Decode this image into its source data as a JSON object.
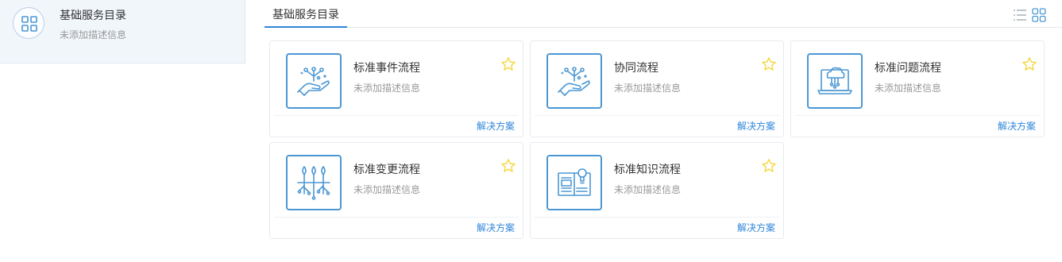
{
  "sidebar": {
    "items": [
      {
        "title": "基础服务目录",
        "description": "未添加描述信息",
        "icon": "grid-apps-icon"
      }
    ]
  },
  "main": {
    "tab_label": "基础服务目录",
    "view_toggle": {
      "list_icon": "list-view-icon",
      "grid_icon": "grid-view-icon",
      "active": "grid"
    }
  },
  "cards": [
    {
      "title": "标准事件流程",
      "description": "未添加描述信息",
      "link": "解决方案",
      "icon": "hand-network-icon"
    },
    {
      "title": "协同流程",
      "description": "未添加描述信息",
      "link": "解决方案",
      "icon": "hand-network-icon"
    },
    {
      "title": "标准问题流程",
      "description": "未添加描述信息",
      "link": "解决方案",
      "icon": "cloud-laptop-icon"
    },
    {
      "title": "标准变更流程",
      "description": "未添加描述信息",
      "link": "解决方案",
      "icon": "plant-circuit-icon"
    },
    {
      "title": "标准知识流程",
      "description": "未添加描述信息",
      "link": "解决方案",
      "icon": "book-idea-icon"
    }
  ],
  "colors": {
    "accent": "#2f86d9",
    "icon_border": "#4b97d4",
    "star": "#f5d63d",
    "sidebar_bg": "#f1f6fb"
  }
}
